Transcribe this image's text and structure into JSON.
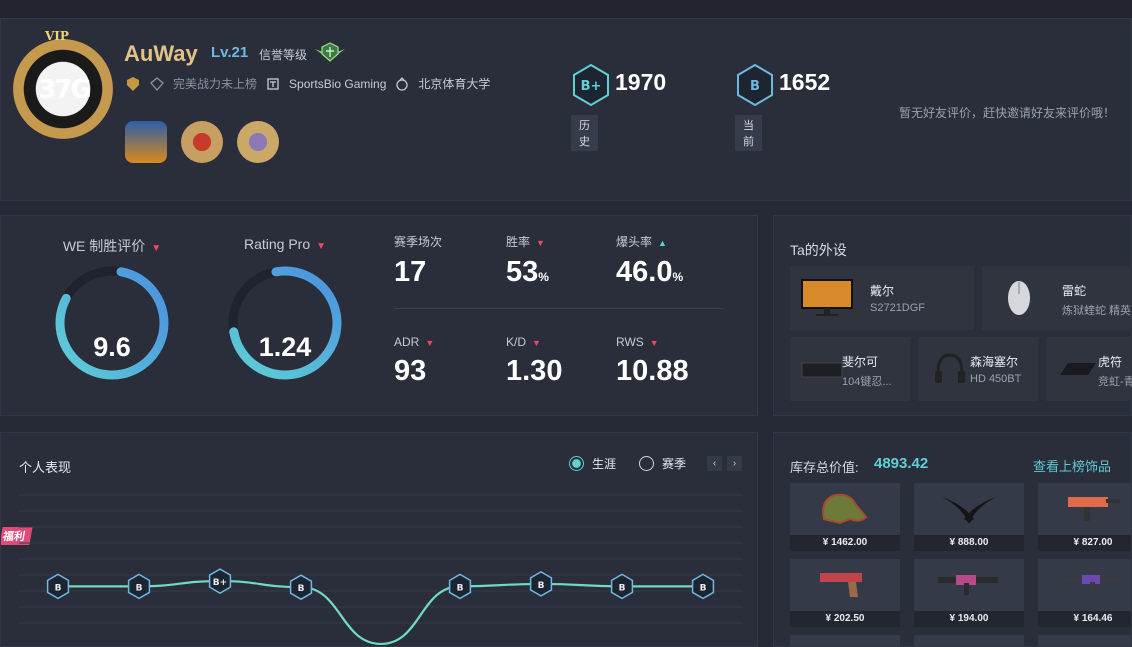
{
  "profile": {
    "vip_label": "VIP",
    "avatar_text": "37G",
    "username": "AuWay",
    "level": "Lv.21",
    "credit_label": "信誉等级",
    "power_rank": "完美战力未上榜",
    "team": "SportsBio Gaming",
    "school": "北京体育大学"
  },
  "ranks": {
    "history": {
      "value": "1970",
      "tag": "历史",
      "badge": "B+"
    },
    "current": {
      "value": "1652",
      "tag": "当前",
      "badge": "B"
    }
  },
  "friend_tip": "暂无好友评价，赶快邀请好友来评价哦！",
  "ratings": {
    "we": {
      "label": "WE 制胜评价",
      "value": "9.6",
      "fraction": 0.8
    },
    "pro": {
      "label": "Rating Pro",
      "value": "1.24",
      "fraction": 0.75
    }
  },
  "stats": {
    "matches": {
      "label": "赛季场次",
      "value": "17"
    },
    "winrate": {
      "label": "胜率",
      "value": "53",
      "unit": "%"
    },
    "headshot": {
      "label": "爆头率",
      "value": "46.0",
      "unit": "%"
    },
    "adr": {
      "label": "ADR",
      "value": "93"
    },
    "kd": {
      "label": "K/D",
      "value": "1.30"
    },
    "rws": {
      "label": "RWS",
      "value": "10.88"
    }
  },
  "gear": {
    "title": "Ta的外设",
    "items": [
      {
        "name": "戴尔",
        "model": "S2721DGF"
      },
      {
        "name": "雷蛇",
        "model": "炼狱蝰蛇 精英"
      },
      {
        "name": "斐尔可",
        "model": "104键忍..."
      },
      {
        "name": "森海塞尔",
        "model": "HD 450BT"
      },
      {
        "name": "虎符",
        "model": "竞虹-青"
      }
    ]
  },
  "performance": {
    "title": "个人表现",
    "tab_career": "生涯",
    "tab_season": "赛季",
    "promo": "福利",
    "trend_badges": [
      "B",
      "B",
      "B+",
      "B",
      "B",
      "B",
      "B",
      "B"
    ],
    "trend_values": [
      588,
      588,
      575,
      590,
      730,
      588,
      582,
      588,
      588,
      588
    ]
  },
  "inventory": {
    "title": "库存总价值:",
    "value": "4893.42",
    "link": "查看上榜饰品",
    "items": [
      {
        "price": "¥ 1462.00",
        "kind": "gloves"
      },
      {
        "price": "¥ 888.00",
        "kind": "knife"
      },
      {
        "price": "¥ 827.00",
        "kind": "smg"
      },
      {
        "price": "¥ 202.50",
        "kind": "pistol"
      },
      {
        "price": "¥ 194.00",
        "kind": "rifle"
      },
      {
        "price": "¥ 164.46",
        "kind": "rifle2"
      }
    ]
  },
  "colors": {
    "accent": "#5fd0d4",
    "gold": "#e3c286",
    "down": "#e84a6a",
    "level": "#6fb8e4"
  }
}
